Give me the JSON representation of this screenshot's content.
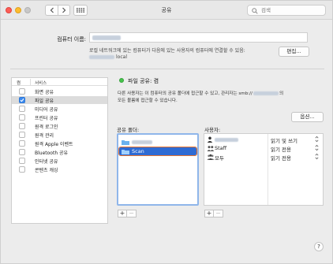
{
  "window": {
    "title": "공유"
  },
  "search": {
    "placeholder": "검색"
  },
  "computer_name": {
    "label": "컴퓨터 이름:",
    "info_line": "로컬 네트워크에 있는 컴퓨터가 다음에 있는 사용자의 컴퓨터에 연결할 수 있음:",
    "local_suffix": "local",
    "edit_label": "편집..."
  },
  "services": {
    "header_on": "켬",
    "header_service": "서비스",
    "items": [
      {
        "label": "화면 공유",
        "checked": false,
        "selected": false
      },
      {
        "label": "파일 공유",
        "checked": true,
        "selected": true
      },
      {
        "label": "미디어 공유",
        "checked": false,
        "selected": false
      },
      {
        "label": "프린터 공유",
        "checked": false,
        "selected": false
      },
      {
        "label": "원격 로그인",
        "checked": false,
        "selected": false
      },
      {
        "label": "원격 관리",
        "checked": false,
        "selected": false
      },
      {
        "label": "원격 Apple 이벤트",
        "checked": false,
        "selected": false
      },
      {
        "label": "Bluetooth 공유",
        "checked": false,
        "selected": false
      },
      {
        "label": "인터넷 공유",
        "checked": false,
        "selected": false
      },
      {
        "label": "콘텐츠 캐싱",
        "checked": false,
        "selected": false
      }
    ]
  },
  "status": {
    "text": "파일 공유: 켬",
    "desc_line1_pre": "다른 사용자는 이 컴퓨터의 공유 폴더에 접근할 수 있고, 관리자는 smb://",
    "desc_line1_post": "의",
    "desc_line2": "모든 볼륨에 접근할 수 있습니다.",
    "color": "#45c44b"
  },
  "options_label": "옵션...",
  "shared_folders": {
    "label": "공유 폴더:",
    "items": [
      {
        "label": "",
        "selected": false
      },
      {
        "label": "Scan",
        "selected": true
      }
    ]
  },
  "users": {
    "label": "사용자:",
    "items": [
      {
        "label": "",
        "permission": "읽기 및 쓰기",
        "icon": "user-icon"
      },
      {
        "label": "Staff",
        "permission": "읽기 전용",
        "icon": "group-icon"
      },
      {
        "label": "모두",
        "permission": "읽기 전용",
        "icon": "everyone-icon"
      }
    ]
  },
  "buttons": {
    "add": "+",
    "remove": "−",
    "help": "?"
  },
  "colors": {
    "accent": "#3b8aef",
    "selection": "#2e6bd3",
    "highlight_outline": "#e8732f"
  }
}
